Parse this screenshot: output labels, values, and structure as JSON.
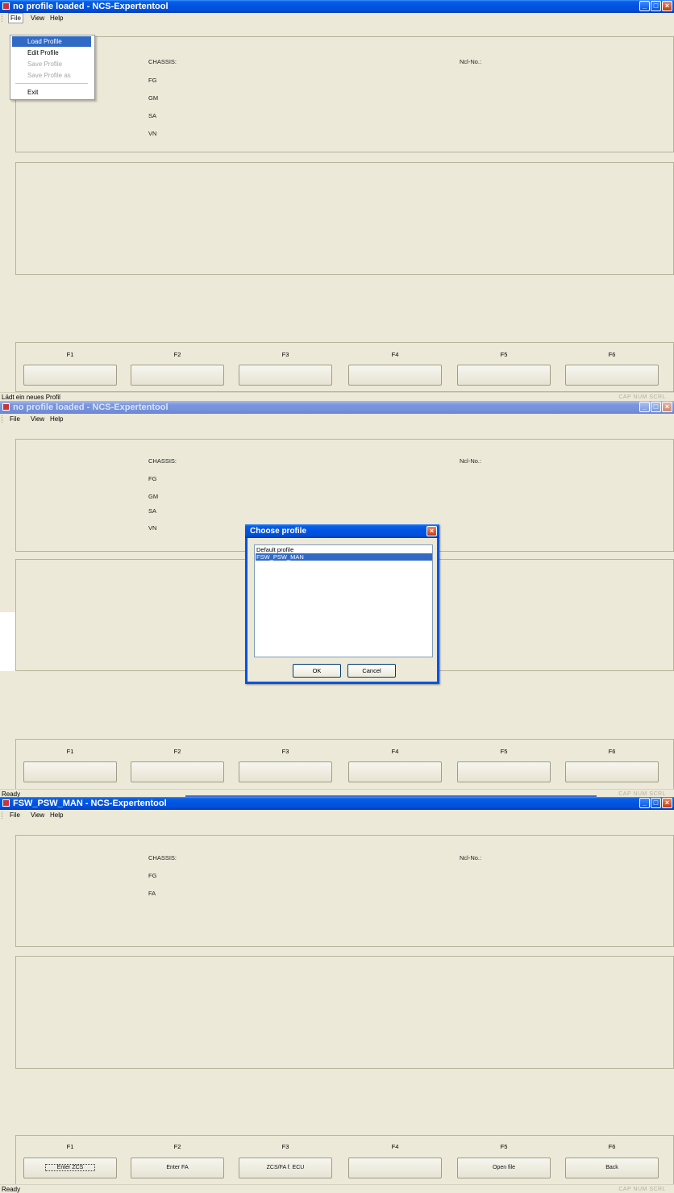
{
  "shot1": {
    "title": "no profile loaded - NCS-Expertentool",
    "menu": [
      "File",
      "View",
      "Help"
    ],
    "dropdown": {
      "items": [
        {
          "label": "Load Profile",
          "state": "highlighted"
        },
        {
          "label": "Edit Profile",
          "state": "enabled"
        },
        {
          "label": "Save Profile",
          "state": "disabled"
        },
        {
          "label": "Save Profile as",
          "state": "disabled"
        },
        {
          "label": "Exit",
          "state": "enabled"
        }
      ]
    },
    "fields": [
      "CHASSIS:",
      "FG",
      "GM",
      "SA",
      "VN"
    ],
    "ncl_label": "Ncl-No.:",
    "fkeys": [
      "F1",
      "F2",
      "F3",
      "F4",
      "F5",
      "F6"
    ],
    "buttons": [
      "",
      "",
      "",
      "",
      "",
      ""
    ],
    "status": "Lädt ein neues Profil",
    "indicators": "CAP NUM SCRL"
  },
  "shot2": {
    "title": "no profile loaded - NCS-Expertentool",
    "menu": [
      "File",
      "View",
      "Help"
    ],
    "fields": [
      "CHASSIS:",
      "FG",
      "GM",
      "SA",
      "VN"
    ],
    "ncl_label": "Ncl-No.:",
    "dialog": {
      "title": "Choose profile",
      "items": [
        "Default profile",
        "FSW_PSW_MAN"
      ],
      "selected_index": 1,
      "ok": "OK",
      "cancel": "Cancel"
    },
    "fkeys": [
      "F1",
      "F2",
      "F3",
      "F4",
      "F5",
      "F6"
    ],
    "buttons": [
      "",
      "",
      "",
      "",
      "",
      ""
    ],
    "status": "Ready",
    "indicators": "CAP NUM SCRL"
  },
  "shot3": {
    "title": "FSW_PSW_MAN - NCS-Expertentool",
    "menu": [
      "File",
      "View",
      "Help"
    ],
    "fields": [
      "CHASSIS:",
      "FG",
      "FA"
    ],
    "ncl_label": "Ncl-No.:",
    "fkeys": [
      "F1",
      "F2",
      "F3",
      "F4",
      "F5",
      "F6"
    ],
    "buttons": [
      "Enter ZCS",
      "Enter FA",
      "ZCS/FA f. ECU",
      "",
      "Open file",
      "Back"
    ],
    "status": "Ready",
    "indicators": "CAP NUM SCRL"
  },
  "colors": {
    "titlebar_active": "#0054e3",
    "window_bg": "#ece9d8",
    "selection": "#316ac5"
  }
}
